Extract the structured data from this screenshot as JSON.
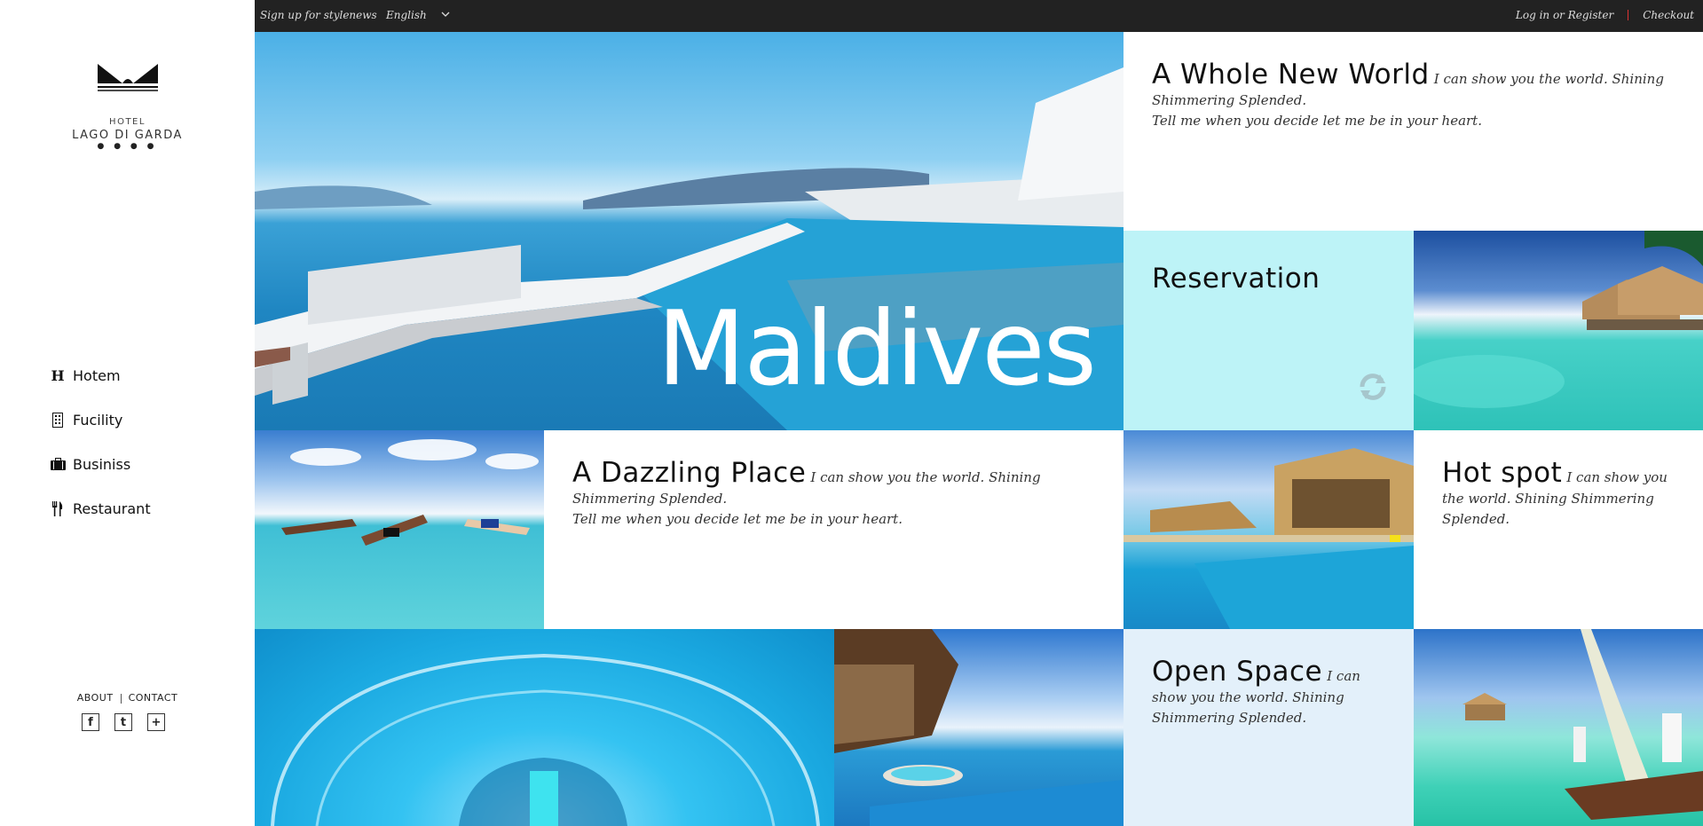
{
  "topbar": {
    "signup": "Sign up for stylenews",
    "language": "English",
    "login": "Log in or Register",
    "checkout": "Checkout"
  },
  "logo": {
    "small": "HOTEL",
    "big": "LAGO DI GARDA",
    "dots": "● ● ● ●"
  },
  "nav": {
    "items": [
      {
        "label": "Hotem",
        "icon": "letter-h-icon"
      },
      {
        "label": "Fucility",
        "icon": "building-icon"
      },
      {
        "label": "Businiss",
        "icon": "briefcase-icon"
      },
      {
        "label": "Restaurant",
        "icon": "fork-knife-icon"
      }
    ]
  },
  "footer": {
    "about": "ABOUT",
    "contact": "CONTACT",
    "social": [
      {
        "icon": "facebook-icon",
        "glyph": "f"
      },
      {
        "icon": "twitter-icon",
        "glyph": "t"
      },
      {
        "icon": "plus-icon",
        "glyph": "+"
      }
    ]
  },
  "hero": {
    "title": "Maldives"
  },
  "tiles": {
    "whole_new_world": {
      "title": "A Whole New World",
      "text1": "I can show you the world. Shining Shimmering Splended.",
      "text2": "Tell me when you decide let me be in your heart."
    },
    "reservation": {
      "title": "Reservation",
      "icon": "refresh-icon"
    },
    "dazzling": {
      "title": "A Dazzling Place",
      "text1": "I can show you the world. Shining Shimmering Splended.",
      "text2": "Tell me when you decide let me be in your heart."
    },
    "hot_spot": {
      "title": "Hot spot",
      "text1": "I can show you the world. Shining Shimmering Splended."
    },
    "open_space": {
      "title": "Open Space",
      "text1": "I can show you the world. Shining Shimmering Splended."
    }
  },
  "colors": {
    "topbar": "#222222",
    "reservation_bg": "#bdf3f7",
    "open_space_bg": "#e3f0fa",
    "accent_red": "#dd3333"
  }
}
